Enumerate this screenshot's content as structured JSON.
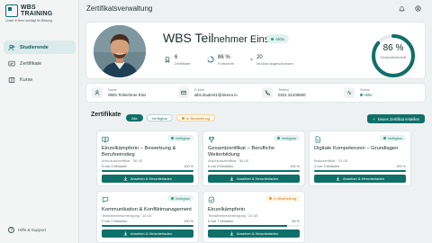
{
  "brand": {
    "name_line1": "WBS",
    "name_line2": "TRAINING",
    "tagline_pre": "Unser",
    "tagline_post": "Herz schlägt für Bildung"
  },
  "sidebar": {
    "items": [
      {
        "label": "Studierende",
        "icon": "users-icon",
        "active": true
      },
      {
        "label": "Zertifikate",
        "icon": "certificate-icon",
        "active": false
      },
      {
        "label": "Kurse",
        "icon": "book-icon",
        "active": false
      }
    ],
    "help_label": "Hilfe & Support"
  },
  "header": {
    "title": "Zertifikatsverwaltung"
  },
  "profile": {
    "name_main": "WBS Teil",
    "name_small": "nehmer Eins",
    "status": "Aktiv",
    "stats": [
      {
        "value": "6",
        "label": "Zertifikate",
        "icon": "award-icon"
      },
      {
        "value": "86 %",
        "label": "Fortschritt",
        "icon": "progress-icon"
      },
      {
        "value": "20",
        "label": "Module abgeschlossen",
        "icon": "stack-icon"
      }
    ],
    "overall_value": "86 %",
    "overall_fraction": 0.86,
    "overall_label": "Gesamtfortschritt"
  },
  "info": [
    {
      "label": "Name",
      "value": "WBS Teilnehmer Eins",
      "icon": "user-icon"
    },
    {
      "label": "E-Mail",
      "value": "wbs.student1@sleeso.io",
      "icon": "mail-icon"
    },
    {
      "label": "Telefon",
      "value": "0221 22106600",
      "icon": "phone-icon"
    },
    {
      "label": "Status",
      "value": "Aktiv",
      "icon": "status-icon"
    }
  ],
  "certificates": {
    "heading": "Zertifikate",
    "filters": [
      "Alle",
      "Verfügbar",
      "In Bearbeitung"
    ],
    "new_button": "Neues Zertifikat erstellen",
    "items": [
      {
        "title": "Einzelkämpferin – Bewerbung & Berufseinstieg",
        "subtitle": "Abschlusszertifikat · 36 UE",
        "progress_text": "5 von 5 Modulen",
        "percent": "100 %",
        "progress": 1.0,
        "status": "Verfügbar",
        "action": "Ansehen & Herunterladen",
        "icon": "certificate-icon"
      },
      {
        "title": "Gesamtzertifikat – Berufliche Weiterbildung",
        "subtitle": "Abschlusszertifikat · 96 UE",
        "progress_text": "8 von 8 Modulen",
        "percent": "100 %",
        "progress": 1.0,
        "status": "Verfügbar",
        "action": "Ansehen & Herunterladen",
        "icon": "trophy-icon"
      },
      {
        "title": "Digitale Kompetenzen – Grundlagen",
        "subtitle": "Basiszertifikat · 24 UE",
        "progress_text": "3 von 3 Modulen",
        "percent": "100 %",
        "progress": 1.0,
        "status": "Verfügbar",
        "action": "Ansehen & Herunterladen",
        "icon": "document-icon"
      },
      {
        "title": "Kommunikation & Konfliktmanagement",
        "subtitle": "Teilnahmebescheinigung · 16 UE",
        "progress_text": "2 von 2 Modulen",
        "percent": "100 %",
        "progress": 1.0,
        "status": "Verfügbar",
        "action": "Ansehen & Herunterladen",
        "icon": "chat-icon"
      },
      {
        "title": "Einzelkämpferin",
        "subtitle": "Teilnahmebescheinigung · 32 UE",
        "progress_text": "6 von 7 Modulen",
        "percent": "86 %",
        "progress": 0.86,
        "status": "In Bearbeitung",
        "action": "Ansehen & Herunterladen",
        "icon": "check-circle-icon"
      }
    ]
  },
  "colors": {
    "accent": "#0f6f69",
    "warning": "#c98322",
    "background": "#eef1f1"
  }
}
